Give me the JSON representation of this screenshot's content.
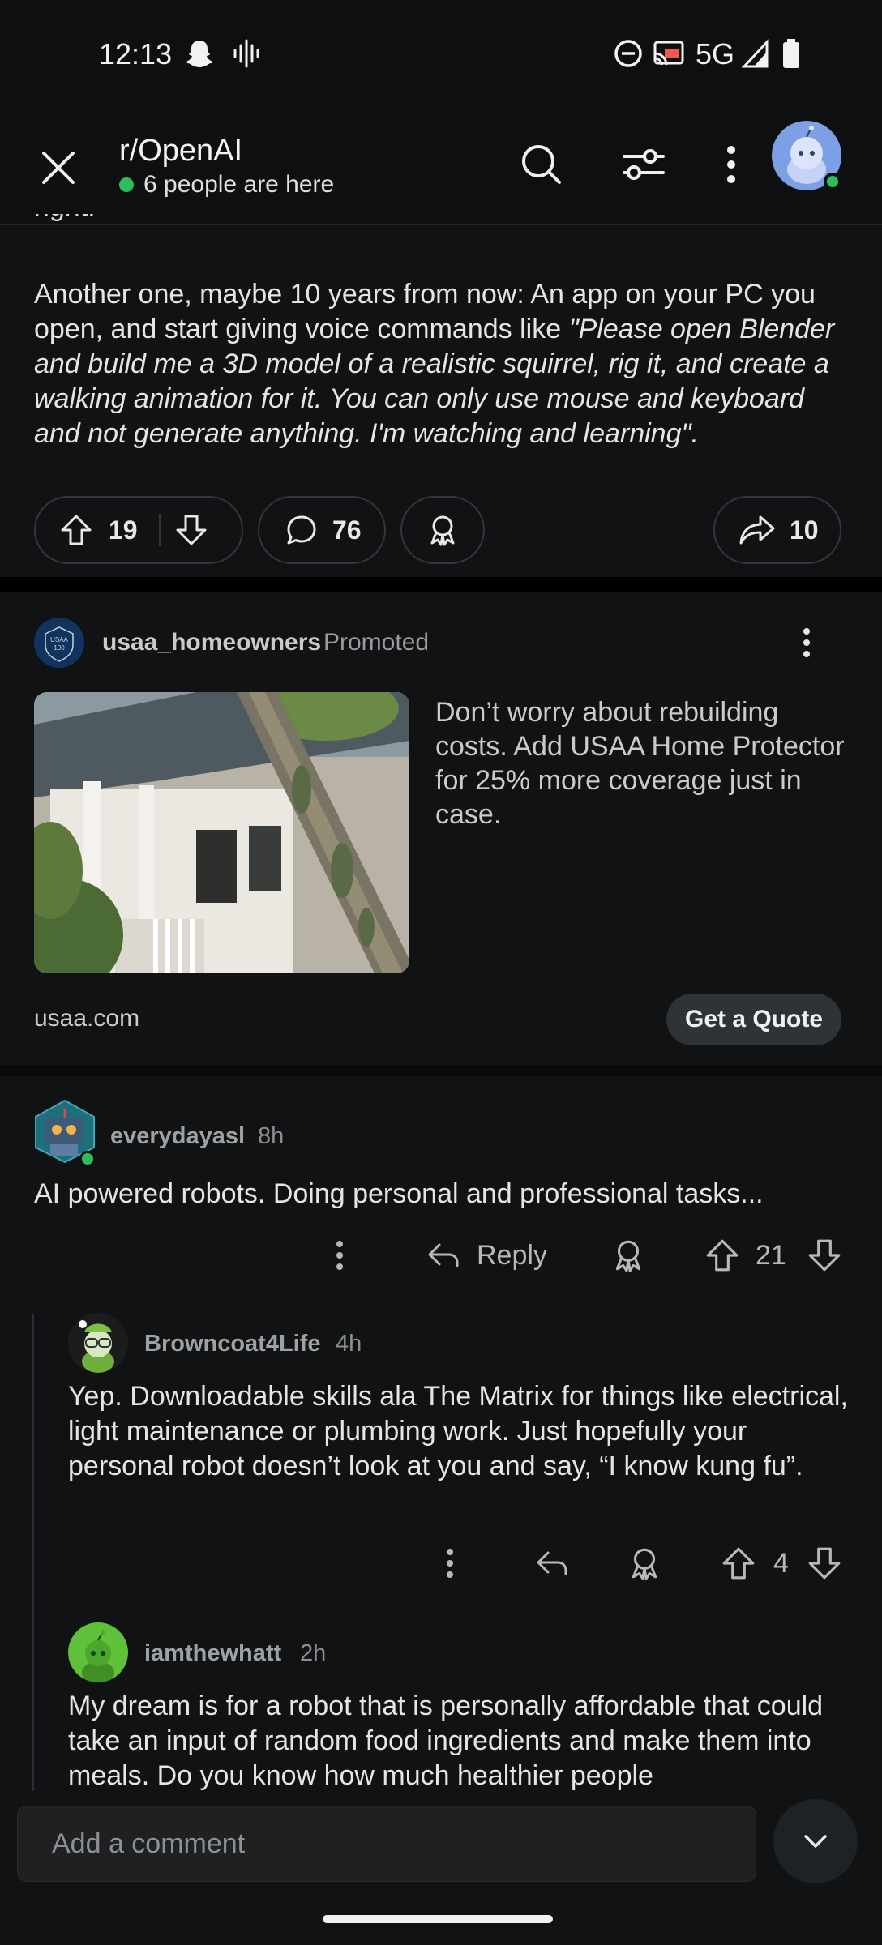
{
  "status_bar": {
    "time": "12:13",
    "network": "5G"
  },
  "header": {
    "subreddit": "r/OpenAI",
    "presence": "6 people are here"
  },
  "post": {
    "partial_line": "right.",
    "body_plain": "Another one, maybe 10 years from now: An app on your PC you open, and start giving voice commands like ",
    "body_quote": "\"Please open Blender and build me a 3D model of a realistic squirrel, rig it, and create a walking animation for it. You can only use mouse and keyboard and not generate anything. I'm watching and learning\".",
    "upvotes": "19",
    "comments": "76",
    "shares": "10"
  },
  "ad": {
    "username": "usaa_homeowners",
    "promoted_label": "Promoted",
    "logo_text": "USAA 100",
    "text": "Don’t worry about rebuilding costs. Add USAA Home Protector for 25% more coverage just in case.",
    "domain": "usaa.com",
    "cta": "Get a Quote"
  },
  "comments": [
    {
      "username": "everydayasl",
      "time": "8h",
      "body": "AI powered robots. Doing personal and professional tasks...",
      "reply_label": "Reply",
      "score": "21"
    },
    {
      "username": "Browncoat4Life",
      "time": "4h",
      "body": "Yep. Downloadable skills ala The Matrix for things like electrical, light maintenance or plumbing work. Just hopefully your personal robot doesn’t look at you and say, “I know kung fu”.",
      "score": "4"
    },
    {
      "username": "iamthewhatt",
      "time": "2h",
      "body": "My dream is for a robot that is personally affordable that could take an input of random food ingredients and make them into meals. Do you know how much healthier people"
    }
  ],
  "composer": {
    "placeholder": "Add a comment"
  },
  "colors": {
    "online": "#2dbd5a",
    "background": "#111213",
    "pill_border": "#33373b"
  }
}
